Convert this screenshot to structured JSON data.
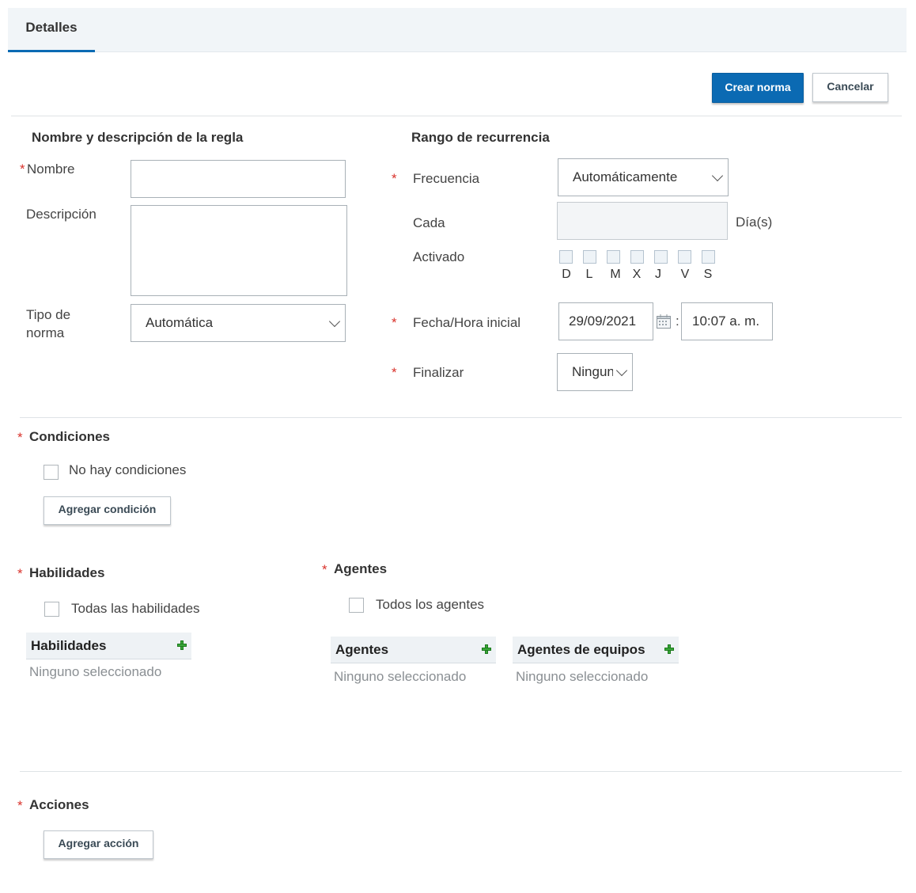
{
  "tabs": {
    "details": "Detalles"
  },
  "toolbar": {
    "create": "Crear norma",
    "cancel": "Cancelar"
  },
  "rule_section": {
    "heading": "Nombre y descripción de la regla",
    "name_label": "Nombre",
    "name_value": "",
    "description_label": "Descripción",
    "description_value": "",
    "type_label_line1": "Tipo de",
    "type_label_line2": "norma",
    "type_value": "Automática"
  },
  "recurrence": {
    "heading": "Rango de recurrencia",
    "frequency_label": "Frecuencia",
    "frequency_value": "Automáticamente",
    "every_label": "Cada",
    "every_value": "",
    "every_unit": "Día(s)",
    "active_label": "Activado",
    "days": [
      "D",
      "L",
      "M",
      "X",
      "J",
      "V",
      "S"
    ],
    "start_label": "Fecha/Hora inicial",
    "start_date": "29/09/2021",
    "time_sep": ":",
    "start_time": "10:07 a. m.",
    "end_label": "Finalizar",
    "end_value": "Ninguno"
  },
  "conditions": {
    "heading": "Condiciones",
    "no_conditions": "No hay condiciones",
    "add_button": "Agregar condición"
  },
  "skills": {
    "heading": "Habilidades",
    "all_label": "Todas las habilidades",
    "panel_title": "Habilidades",
    "none_text": "Ninguno seleccionado"
  },
  "agents": {
    "heading": "Agentes",
    "all_label": "Todos los agentes",
    "panel_title": "Agentes",
    "none_text": "Ninguno seleccionado",
    "team_panel_title": "Agentes de equipos",
    "team_none_text": "Ninguno seleccionado"
  },
  "actions": {
    "heading": "Acciones",
    "add_button": "Agregar acción"
  },
  "required_marker": "*",
  "colors": {
    "primary": "#0b6ab3",
    "required": "#d9322b",
    "plus": "#3aa83a"
  }
}
